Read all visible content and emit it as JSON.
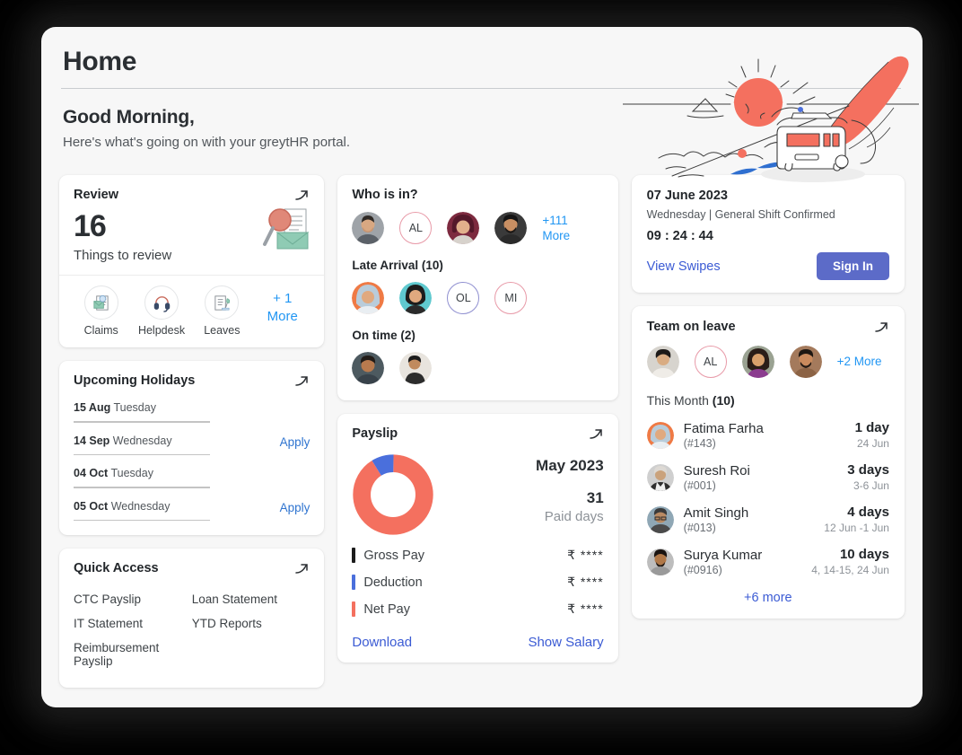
{
  "header": {
    "page_title": "Home",
    "greeting": "Good Morning,",
    "subtitle": "Here's what's going on with your greytHR portal.",
    "illustration": "sunrise-road-van-illustration"
  },
  "review": {
    "title": "Review",
    "count": "16",
    "caption": "Things to review",
    "expand_icon": "arrow-up-right-icon",
    "illustration": "magnifier-envelope-icon",
    "actions": [
      {
        "label": "Claims",
        "icon": "claims-document-icon"
      },
      {
        "label": "Helpdesk",
        "icon": "headset-icon"
      },
      {
        "label": "Leaves",
        "icon": "leaves-document-icon"
      }
    ],
    "more_label": "+ 1\nMore",
    "more_count": "+ 1",
    "more_word": "More"
  },
  "holidays": {
    "title": "Upcoming Holidays",
    "expand_icon": "arrow-up-right-icon",
    "rows": [
      {
        "date": "15 Aug",
        "day": "Tuesday",
        "action": ""
      },
      {
        "date": "14 Sep",
        "day": "Wednesday",
        "action": "Apply"
      },
      {
        "date": "04 Oct",
        "day": "Tuesday",
        "action": ""
      },
      {
        "date": "05 Oct",
        "day": "Wednesday",
        "action": "Apply"
      }
    ]
  },
  "quick_access": {
    "title": "Quick Access",
    "expand_icon": "arrow-up-right-icon",
    "items": [
      "CTC Payslip",
      "Loan Statement",
      "IT Statement",
      "YTD Reports",
      "Reimbursement Payslip"
    ]
  },
  "who_is_in": {
    "title": "Who is in?",
    "avatars": [
      {
        "type": "photo",
        "tone": "#9ea3a8",
        "skin": "#d8a882",
        "hair": "#2f2a26"
      },
      {
        "type": "initials",
        "text": "AL",
        "ring": "#e89aa8"
      },
      {
        "type": "photo",
        "tone": "#7d2a3f",
        "skin": "#e2b08c",
        "hair": "#54182a"
      },
      {
        "type": "photo",
        "tone": "#3a3a3a",
        "skin": "#c98f63",
        "hair": "#141414"
      }
    ],
    "more_count": "+111",
    "more_word": "More",
    "late_title": "Late Arrival (10)",
    "late_avatars": [
      {
        "type": "photo",
        "tone": "#ef7a45",
        "skin": "#e0a97f",
        "hair": "#b9ccda"
      },
      {
        "type": "photo",
        "tone": "#5fc9cf",
        "skin": "#e0a97f",
        "hair": "#1d1d1d"
      },
      {
        "type": "initials",
        "text": "OL",
        "ring": "#8f8fd0"
      },
      {
        "type": "initials",
        "text": "MI",
        "ring": "#e89aa8"
      }
    ],
    "ontime_title": "On time (2)",
    "ontime_avatars": [
      {
        "type": "photo",
        "tone": "#4d5a60",
        "skin": "#b87a4e",
        "hair": "#221c18"
      },
      {
        "type": "photo",
        "tone": "#e8e4de",
        "skin": "#c08a5e",
        "hair": "#1c1c1c"
      }
    ]
  },
  "payslip": {
    "title": "Payslip",
    "expand_icon": "arrow-up-right-icon",
    "month": "May 2023",
    "paid_days": "31",
    "paid_days_label": "Paid days",
    "legend": [
      {
        "label": "Gross Pay",
        "value": "₹ ****",
        "color": "#1c1c1c"
      },
      {
        "label": "Deduction",
        "value": "₹ ****",
        "color": "#4a6fdc"
      },
      {
        "label": "Net Pay",
        "value": "₹ ****",
        "color": "#f4705f"
      }
    ],
    "download_label": "Download",
    "show_salary_label": "Show Salary"
  },
  "attendance": {
    "date": "07 June 2023",
    "shift": "Wednesday | General Shift Confirmed",
    "timer": "09 : 24 : 44",
    "view_swipes_label": "View Swipes",
    "signin_label": "Sign In",
    "signin_color": "#5c6bc8"
  },
  "team_on_leave": {
    "title": "Team on leave",
    "expand_icon": "arrow-up-right-icon",
    "avatars": [
      {
        "type": "photo",
        "tone": "#d7d4ce",
        "skin": "#d9ac82",
        "hair": "#1d1a18"
      },
      {
        "type": "initials",
        "text": "AL",
        "ring": "#e89aa8"
      },
      {
        "type": "photo",
        "tone": "#9aa292",
        "skin": "#d8a06c",
        "hair": "#2a1d18"
      },
      {
        "type": "photo",
        "tone": "#a47a5c",
        "skin": "#c98a5d",
        "hair": "#1e1712"
      }
    ],
    "more_label": "+2 More",
    "month_label": "This Month",
    "month_count": "(10)",
    "rows": [
      {
        "name": "Fatima Farha",
        "id": "(#143)",
        "days": "1 day",
        "dates": "24 Jun",
        "tone": "#ef7a45",
        "skin": "#e0a97f",
        "hair": "#b9ccda"
      },
      {
        "name": "Suresh Roi",
        "id": "(#001)",
        "days": "3 days",
        "dates": "3-6 Jun",
        "tone": "#cfcfcf",
        "skin": "#caa27c",
        "hair": "#ddd9d4"
      },
      {
        "name": "Amit Singh",
        "id": "(#013)",
        "days": "4 days",
        "dates": "12 Jun -1 Jun",
        "tone": "#8fa7b5",
        "skin": "#b98a63",
        "hair": "#3a3a3a"
      },
      {
        "name": "Surya Kumar",
        "id": "(#0916)",
        "days": "10 days",
        "dates": "4, 14-15, 24 Jun",
        "tone": "#bdbdbd",
        "skin": "#b07848",
        "hair": "#1a1411"
      }
    ],
    "footer_more": "+6 more"
  },
  "chart_data": {
    "type": "pie",
    "title": "Payslip breakdown",
    "categories": [
      "Net Pay",
      "Deduction"
    ],
    "values": [
      91,
      9
    ],
    "colors": [
      "#f4705f",
      "#4a6fdc"
    ],
    "legend": "right"
  }
}
